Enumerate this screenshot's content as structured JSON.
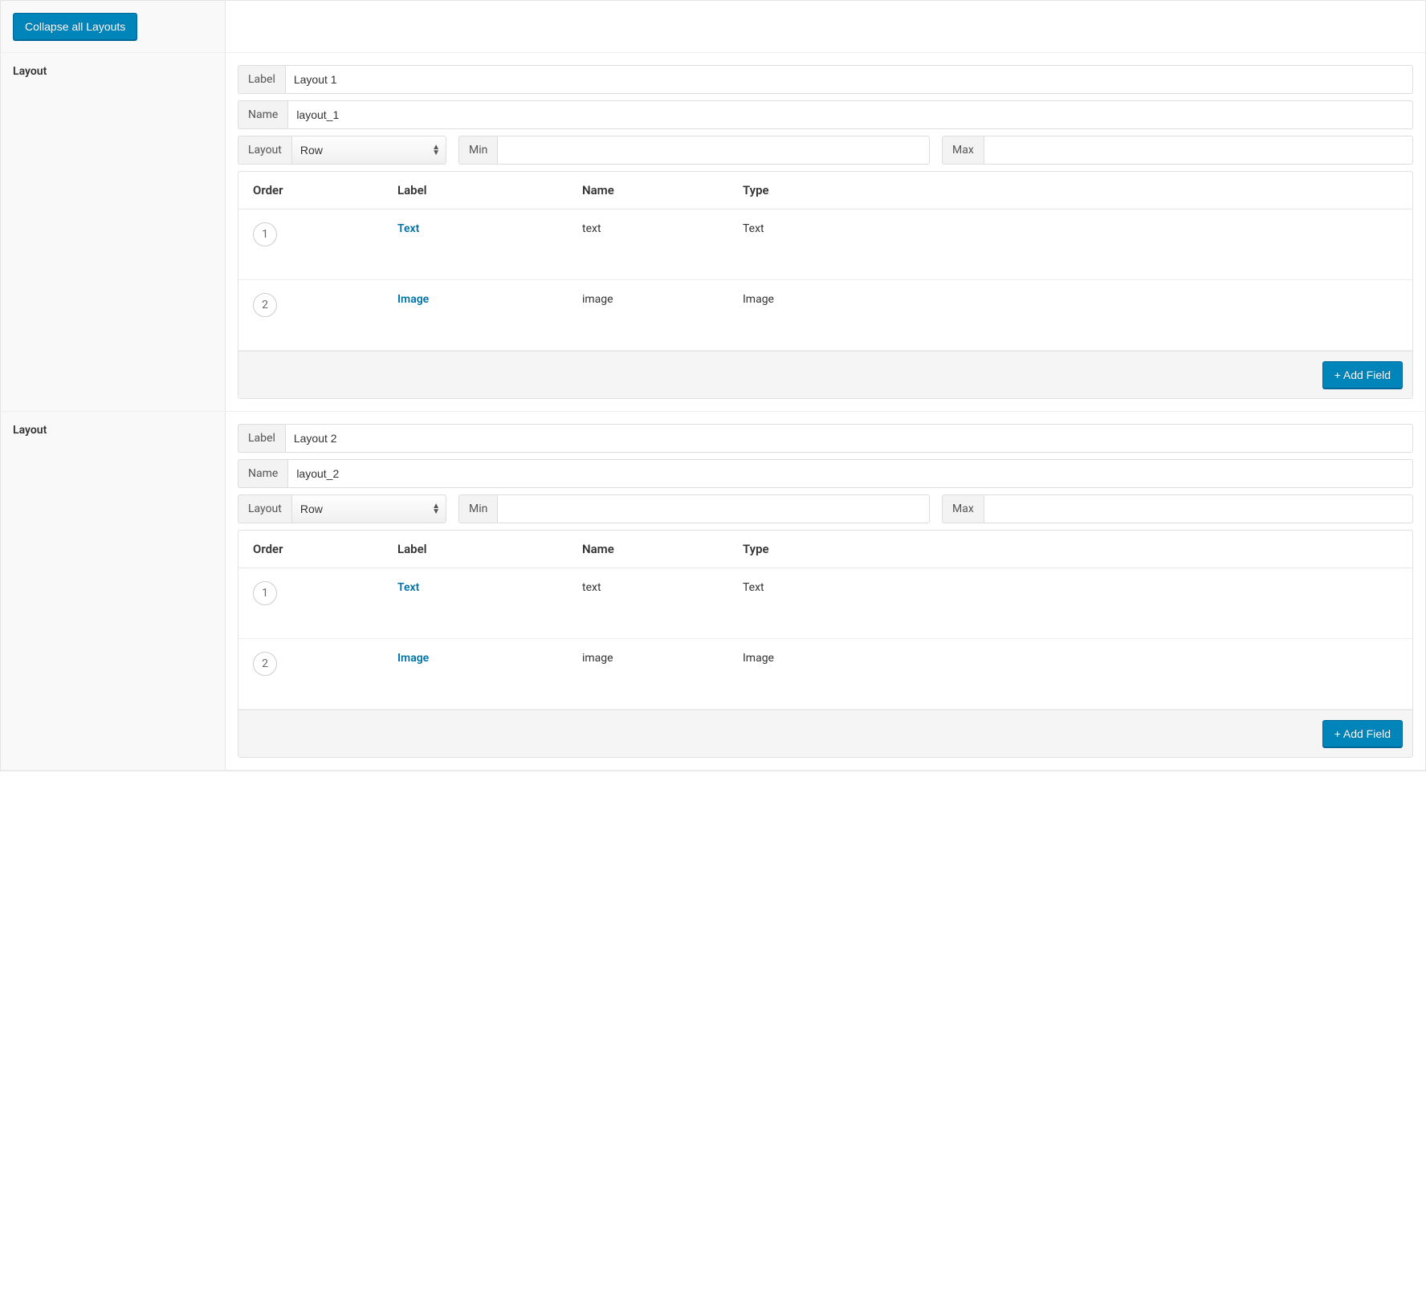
{
  "toolbar": {
    "collapse_label": "Collapse all Layouts"
  },
  "labels": {
    "layout_section": "Layout",
    "label_addon": "Label",
    "name_addon": "Name",
    "layout_addon": "Layout",
    "min_addon": "Min",
    "max_addon": "Max",
    "add_field": "+ Add Field"
  },
  "table_headers": {
    "order": "Order",
    "label": "Label",
    "name": "Name",
    "type": "Type"
  },
  "layouts": [
    {
      "label_value": "Layout 1",
      "name_value": "layout_1",
      "layout_select": "Row",
      "min_value": "",
      "max_value": "",
      "fields": [
        {
          "order": "1",
          "label": "Text",
          "name": "text",
          "type": "Text"
        },
        {
          "order": "2",
          "label": "Image",
          "name": "image",
          "type": "Image"
        }
      ]
    },
    {
      "label_value": "Layout 2",
      "name_value": "layout_2",
      "layout_select": "Row",
      "min_value": "",
      "max_value": "",
      "fields": [
        {
          "order": "1",
          "label": "Text",
          "name": "text",
          "type": "Text"
        },
        {
          "order": "2",
          "label": "Image",
          "name": "image",
          "type": "Image"
        }
      ]
    }
  ]
}
